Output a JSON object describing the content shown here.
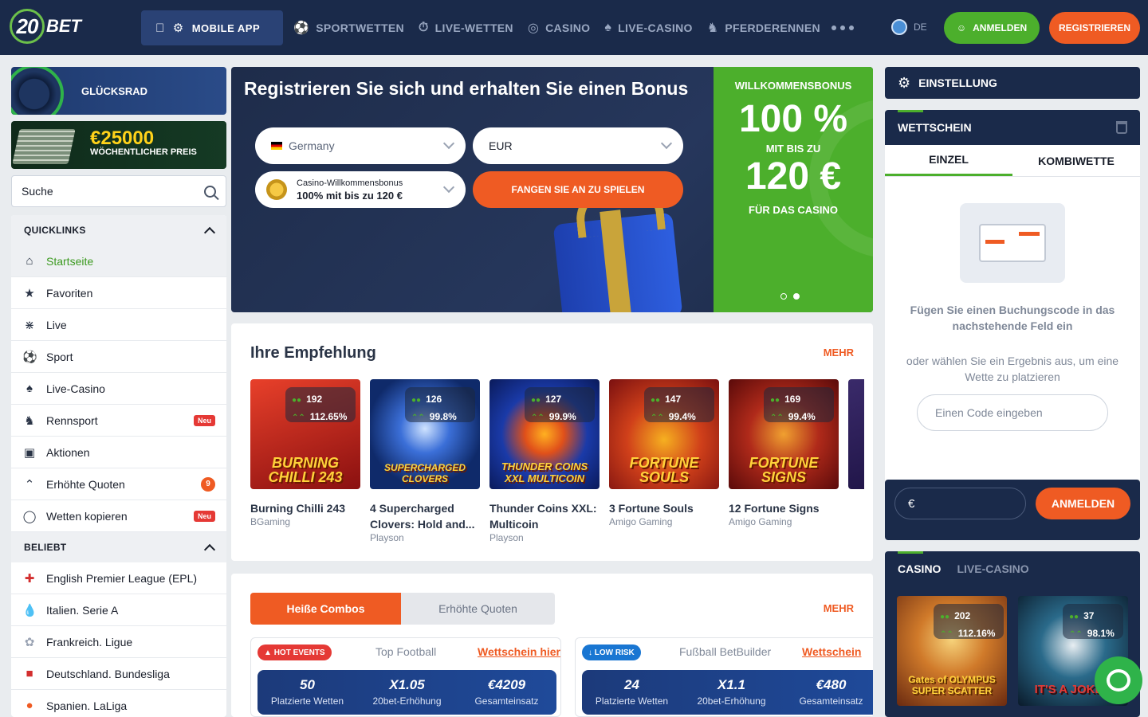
{
  "header": {
    "logo_num": "20",
    "logo_text": "BET",
    "mobile_app": "MOBILE APP",
    "nav": [
      "SPORTWETTEN",
      "LIVE-WETTEN",
      "CASINO",
      "LIVE-CASINO",
      "PFERDERENNEN"
    ],
    "language": "DE",
    "login": "ANMELDEN",
    "register": "REGISTRIEREN"
  },
  "sidebar": {
    "wheel_label": "GLÜCKSRAD",
    "prize_amount": "€25000",
    "prize_label": "WÖCHENTLICHER PREIS",
    "search_placeholder": "Suche",
    "quicklinks_title": "QUICKLINKS",
    "quicklinks": [
      {
        "label": "Startseite",
        "icon": "home-icon"
      },
      {
        "label": "Favoriten",
        "icon": "star-icon"
      },
      {
        "label": "Live",
        "icon": "broadcast-icon"
      },
      {
        "label": "Sport",
        "icon": "soccer-ball-icon"
      },
      {
        "label": "Live-Casino",
        "icon": "cards-icon"
      },
      {
        "label": "Rennsport",
        "icon": "horse-icon",
        "badge": "Neu"
      },
      {
        "label": "Aktionen",
        "icon": "gift-icon"
      },
      {
        "label": "Erhöhte Quoten",
        "icon": "boost-icon",
        "count": "9"
      },
      {
        "label": "Wetten kopieren",
        "icon": "copy-bet-icon",
        "badge": "Neu"
      }
    ],
    "popular_title": "BELIEBT",
    "popular": [
      {
        "label": "English Premier League (EPL)",
        "icon": "england-flag-icon"
      },
      {
        "label": "Italien. Serie A",
        "icon": "serie-a-icon"
      },
      {
        "label": "Frankreich. Ligue",
        "icon": "ligue-icon"
      },
      {
        "label": "Deutschland. Bundesliga",
        "icon": "bundesliga-icon"
      },
      {
        "label": "Spanien. LaLiga",
        "icon": "laliga-icon"
      }
    ]
  },
  "hero": {
    "title": "Registrieren Sie sich und erhalten Sie einen Bonus",
    "country": "Germany",
    "currency": "EUR",
    "bonus_title": "Casino-Willkommensbonus",
    "bonus_value": "100% mit bis zu 120 €",
    "cta": "FANGEN SIE AN ZU SPIELEN",
    "welcome": "WILLKOMMENSBONUS",
    "percent": "100 %",
    "upto": "MIT BIS ZU",
    "amount": "120 €",
    "for_casino": "FÜR DAS CASINO"
  },
  "recommendations": {
    "title": "Ihre Empfehlung",
    "more": "MEHR",
    "games": [
      {
        "name": "Burning Chilli 243",
        "provider": "BGaming",
        "players": "192",
        "rtp": "112.65%",
        "art": "BURNING CHILLI 243",
        "color": "#c0201a"
      },
      {
        "name": "4 Supercharged Clovers: Hold and...",
        "provider": "Playson",
        "players": "126",
        "rtp": "99.8%",
        "art": "SUPERCHARGED CLOVERS",
        "color": "#1b3f8a"
      },
      {
        "name": "Thunder Coins XXL: Multicoin",
        "provider": "Playson",
        "players": "127",
        "rtp": "99.9%",
        "art": "THUNDER COINS XXL MULTICOIN",
        "color": "#1f3fa8"
      },
      {
        "name": "3 Fortune Souls",
        "provider": "Amigo Gaming",
        "players": "147",
        "rtp": "99.4%",
        "art": "FORTUNE SOULS",
        "color": "#c0301a"
      },
      {
        "name": "12 Fortune Signs",
        "provider": "Amigo Gaming",
        "players": "169",
        "rtp": "99.4%",
        "art": "FORTUNE SIGNS",
        "color": "#a01818"
      }
    ]
  },
  "combos": {
    "tab_hot": "Heiße Combos",
    "tab_quotes": "Erhöhte Quoten",
    "more": "MEHR",
    "cards": [
      {
        "tag": "HOT EVENTS",
        "tag_color": "#e53935",
        "title": "Top Football",
        "link": "Wettschein hier",
        "placed": "50",
        "placed_label": "Platzierte Wetten",
        "boost": "X1.05",
        "boost_label": "20bet-Erhöhung",
        "stake": "€4209",
        "stake_label": "Gesamteinsatz"
      },
      {
        "tag": "LOW RISK",
        "tag_color": "#1976d2",
        "title": "Fußball BetBuilder",
        "link": "Wettschein",
        "placed": "24",
        "placed_label": "Platzierte Wetten",
        "boost": "X1.1",
        "boost_label": "20bet-Erhöhung",
        "stake": "€480",
        "stake_label": "Gesamteinsatz"
      }
    ]
  },
  "rightpanel": {
    "settings": "EINSTELLUNG",
    "betslip": "WETTSCHEIN",
    "tab_single": "EINZEL",
    "tab_combi": "KOMBIWETTE",
    "text1": "Fügen Sie einen Buchungscode in das nachstehende Feld ein",
    "text2": "oder wählen Sie ein Ergebnis aus, um eine Wette zu platzieren",
    "code_placeholder": "Einen Code eingeben",
    "euro": "€",
    "login": "ANMELDEN",
    "tab_casino": "CASINO",
    "tab_live_casino": "LIVE-CASINO",
    "casino_games": [
      {
        "art": "Gates of OLYMPUS SUPER SCATTER",
        "players": "202",
        "rtp": "112.16%",
        "color": "#c46a2a"
      },
      {
        "art": "IT'S A JOKER",
        "players": "37",
        "rtp": "98.1%",
        "color": "#1a4a6a"
      }
    ]
  }
}
